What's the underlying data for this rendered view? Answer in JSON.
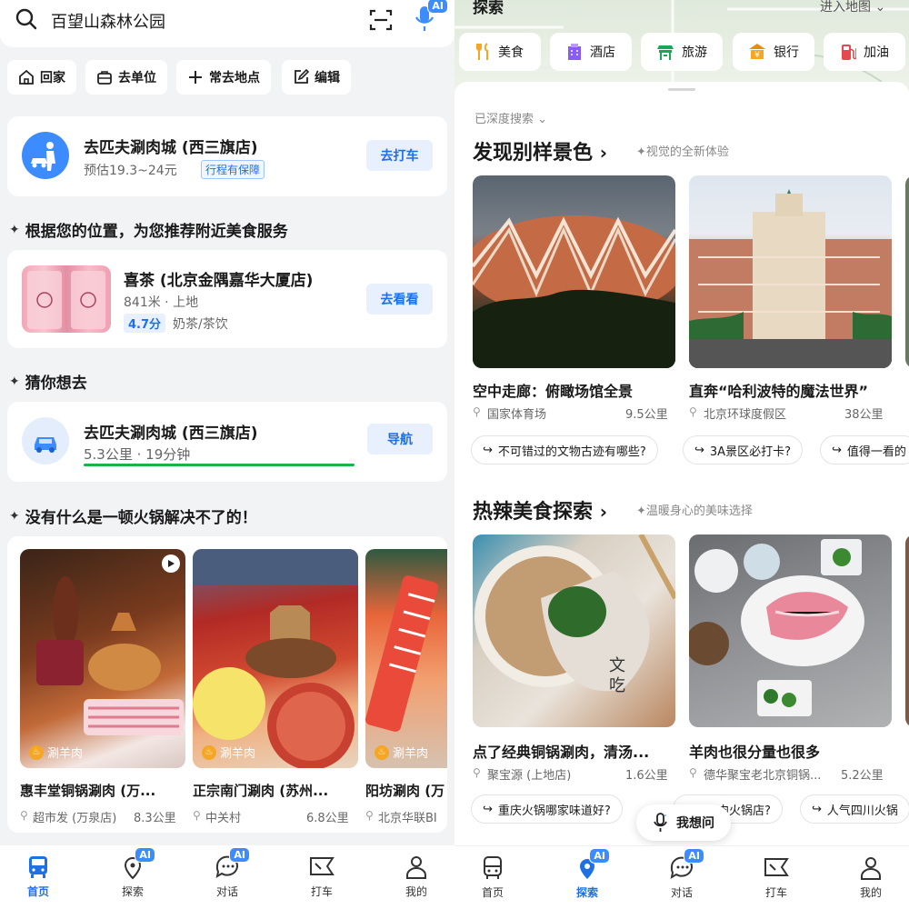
{
  "left": {
    "search": {
      "text": "百望山森林公园",
      "ai_badge": "AI"
    },
    "quick_buttons": [
      "回家",
      "去单位",
      "常去地点",
      "编辑"
    ],
    "taxi_card": {
      "title": "去匹夫涮肉城 (西三旗店)",
      "estimate": "预估19.3~24元",
      "badge": "行程有保障",
      "action": "去打车"
    },
    "rec_header": "根据您的位置，为您推荐附近美食服务",
    "rec_card": {
      "title": "喜茶 (北京金隅嘉华大厦店)",
      "meta": "841米 · 上地",
      "score": "4.7分",
      "category": "奶茶/茶饮",
      "action": "去看看"
    },
    "guess_header": "猜你想去",
    "guess_card": {
      "title": "去匹夫涮肉城 (西三旗店)",
      "meta": "5.3公里 · 19分钟",
      "action": "导航"
    },
    "hotpot_header": "没有什么是一顿火锅解决不了的！",
    "hotpot_items": [
      {
        "tag": "涮羊肉",
        "name": "惠丰堂铜锅涮肉 (万...",
        "place": "超市发 (万泉店)",
        "dist": "8.3公里"
      },
      {
        "tag": "涮羊肉",
        "name": "正宗南门涮肉 (苏州...",
        "place": "中关村",
        "dist": "6.8公里"
      },
      {
        "tag": "涮羊肉",
        "name": "阳坊涮肉 (万",
        "place": "北京华联BI",
        "dist": ""
      }
    ],
    "tabs": [
      {
        "label": "首页",
        "ai": ""
      },
      {
        "label": "探索",
        "ai": "AI"
      },
      {
        "label": "对话",
        "ai": "AI"
      },
      {
        "label": "打车",
        "ai": ""
      },
      {
        "label": "我的",
        "ai": ""
      }
    ]
  },
  "right": {
    "header": {
      "title": "探索",
      "map_link": "进入地图"
    },
    "categories": [
      {
        "label": "美食",
        "icon": "fork-knife-icon",
        "color": "#f5a623"
      },
      {
        "label": "酒店",
        "icon": "hotel-icon",
        "color": "#8a5cf6"
      },
      {
        "label": "旅游",
        "icon": "tour-icon",
        "color": "#1aa55a"
      },
      {
        "label": "银行",
        "icon": "bank-icon",
        "color": "#f08a00"
      },
      {
        "label": "加油",
        "icon": "fuel-icon",
        "color": "#e5484d"
      }
    ],
    "deep_search": "已深度搜索",
    "section1": {
      "title": "发现别样景色",
      "subtitle": "视觉的全新体验",
      "items": [
        {
          "name": "空中走廊：俯瞰场馆全景",
          "place": "国家体育场",
          "dist": "9.5公里"
        },
        {
          "name": "直奔“哈利波特的魔法世界”",
          "place": "北京环球度假区",
          "dist": "38公里"
        }
      ],
      "chips": [
        "不可错过的文物古迹有哪些?",
        "3A景区必打卡?",
        "值得一看的"
      ]
    },
    "section2": {
      "title": "热辣美食探索",
      "subtitle": "温暖身心的美味选择",
      "items": [
        {
          "name": "点了经典铜锅涮肉，清汤...",
          "place": "聚宝源 (上地店)",
          "dist": "1.6公里"
        },
        {
          "name": "羊肉也很分量也很多",
          "place": "德华聚宝老北京铜锅...",
          "dist": "5.2公里"
        }
      ],
      "chips": [
        "重庆火锅哪家味道好?",
        "肉火锅店?",
        "人气四川火锅"
      ]
    },
    "ask_button": "我想问",
    "tabs": [
      {
        "label": "首页",
        "ai": ""
      },
      {
        "label": "探索",
        "ai": "AI"
      },
      {
        "label": "对话",
        "ai": "AI"
      },
      {
        "label": "打车",
        "ai": ""
      },
      {
        "label": "我的",
        "ai": ""
      }
    ]
  }
}
